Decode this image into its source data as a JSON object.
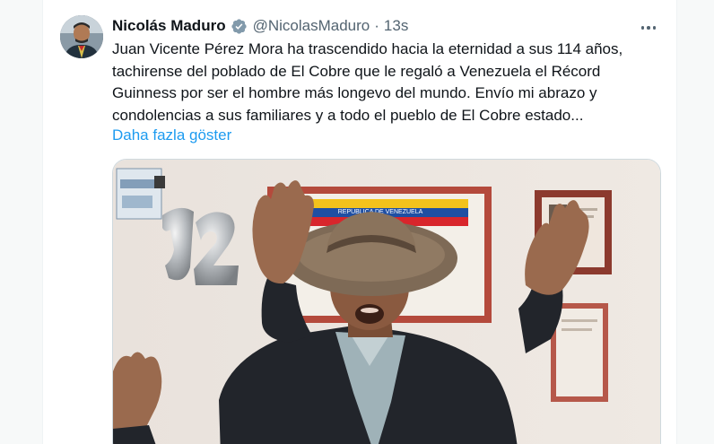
{
  "tweet": {
    "author_name": "Nicolás Maduro",
    "verified_icon": "verified-badge-icon",
    "handle": "@NicolasMaduro",
    "separator": "·",
    "time": "13s",
    "text_lines": [
      "Juan Vicente Pérez Mora ha trascendido hacia la eternidad a sus 114 años,",
      "tachirense del poblado de El Cobre que le regaló a Venezuela el Récord",
      "Guinness por ser el hombre más longevo del mundo. Envío mi abrazo y",
      "condolencias a sus familiares y a todo el pueblo de El Cobre estado..."
    ],
    "show_more": "Daha fazla göster",
    "more_icon": "more-options-icon"
  },
  "media": {
    "certificate_text": "REPUBLICA DE VENEZUELA",
    "colors": {
      "flag_yellow": "#f3c21c",
      "flag_blue": "#1f4fa3",
      "flag_red": "#d8262c",
      "link": "#1d9bf0",
      "verified": "#829aab"
    }
  }
}
